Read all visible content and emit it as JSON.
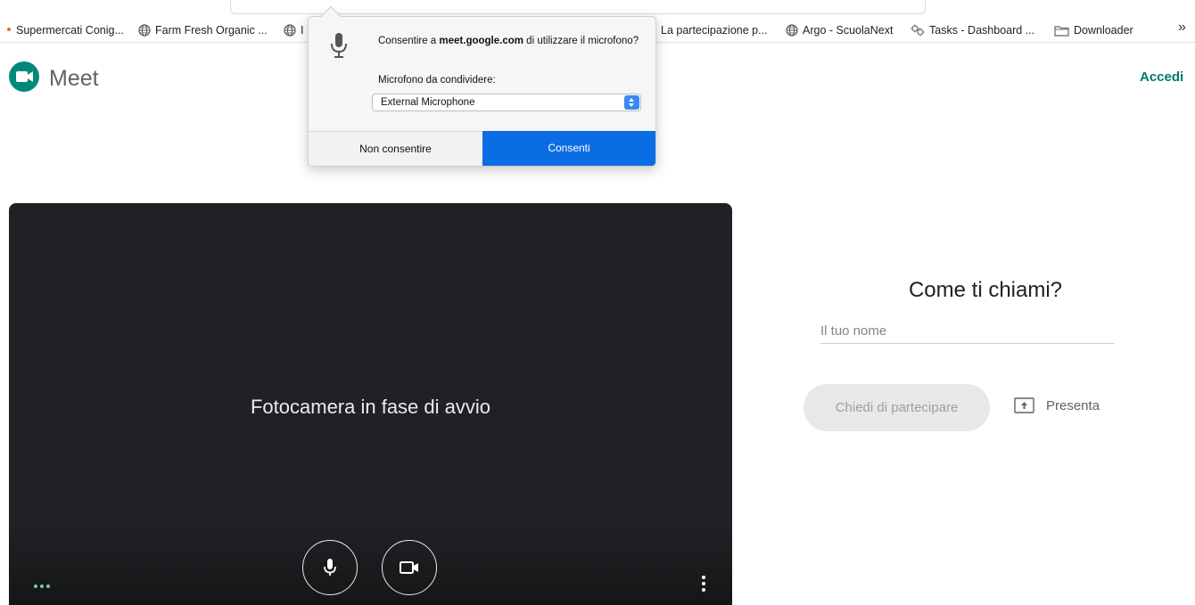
{
  "bookmarks": {
    "items": [
      {
        "label": "Supermercati Conig..."
      },
      {
        "label": "Farm Fresh Organic ..."
      },
      {
        "label": "I"
      },
      {
        "label": "La partecipazione p..."
      },
      {
        "label": "Argo - ScuolaNext"
      },
      {
        "label": "Tasks - Dashboard ..."
      },
      {
        "label": "Downloader"
      }
    ],
    "more_label": "»"
  },
  "header": {
    "app_name": "Meet",
    "sign_in": "Accedi"
  },
  "permission_popup": {
    "question_prefix": "Consentire a ",
    "site": "meet.google.com",
    "question_suffix": " di utilizzare il microfono?",
    "device_label": "Microfono da condividere:",
    "selected_device": "External Microphone",
    "deny_label": "Non consentire",
    "allow_label": "Consenti",
    "allow_color": "#0b6de3"
  },
  "preview": {
    "status_text": "Fotocamera in fase di avvio"
  },
  "join_panel": {
    "title": "Come ti chiami?",
    "name_placeholder": "Il tuo nome",
    "name_value": "",
    "ask_to_join_label": "Chiedi di partecipare",
    "present_label": "Presenta"
  },
  "colors": {
    "accent": "#00796b",
    "video_bg": "#202124"
  }
}
